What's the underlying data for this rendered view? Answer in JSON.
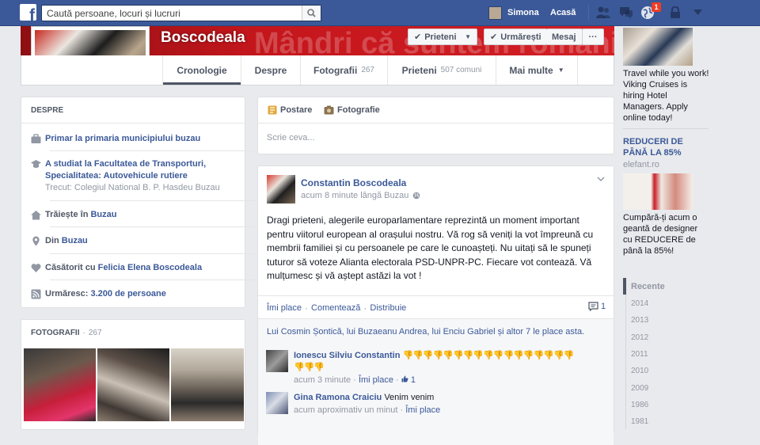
{
  "topbar": {
    "logo": "f",
    "search_placeholder": "Caută persoane, locuri și lucruri",
    "user_name": "Simona",
    "home_label": "Acasă",
    "notification_count": "1",
    "icons": [
      "friend-requests-icon",
      "messages-icon",
      "notifications-icon",
      "privacy-lock-icon",
      "settings-caret-icon"
    ]
  },
  "profile": {
    "name": "Boscodeala",
    "cover_motto": "Mândri că suntem români.",
    "buttons": {
      "friends": "Prieteni",
      "following": "Urmărești",
      "message": "Mesaj",
      "more": "···"
    },
    "tabs": [
      {
        "label": "Cronologie",
        "count": ""
      },
      {
        "label": "Despre",
        "count": ""
      },
      {
        "label": "Fotografii",
        "count": "267"
      },
      {
        "label": "Prieteni",
        "count": "507 comuni"
      },
      {
        "label": "Mai multe",
        "count": ""
      }
    ]
  },
  "about": {
    "title": "DESPRE",
    "items": [
      {
        "icon": "briefcase-icon",
        "text": "Primar la primaria municipiului buzau",
        "sub": ""
      },
      {
        "icon": "education-icon",
        "text": "A studiat la Facultatea de Transporturi, Specialitatea: Autovehicule rutiere",
        "sub": "Trecut: Colegiul National B. P. Hasdeu Buzau"
      },
      {
        "icon": "home-icon",
        "prefix": "Trăiește în ",
        "text": "Buzau",
        "sub": ""
      },
      {
        "icon": "location-pin-icon",
        "prefix": "Din ",
        "text": "Buzau",
        "sub": ""
      },
      {
        "icon": "heart-icon",
        "prefix": "Căsătorit cu ",
        "text": "Felicia Elena Boscodeala",
        "sub": ""
      },
      {
        "icon": "rss-icon",
        "prefix": "Urmăresc: ",
        "text": "3.200 de persoane",
        "sub": ""
      }
    ]
  },
  "photos": {
    "title": "FOTOGRAFII",
    "count": "267"
  },
  "composer": {
    "post_tab": "Postare",
    "photo_tab": "Fotografie",
    "placeholder": "Scrie ceva..."
  },
  "post": {
    "author": "Constantin Boscodeala",
    "meta": "acum 8 minute lângă Buzau",
    "body": "Dragi prieteni, alegerile europarlamentare reprezintă un moment important pentru viitorul european al orașului nostru. Vă rog să veniți la vot împreună cu membrii familiei și cu persoanele pe care le cunoașteți. Nu uitați să le spuneți tuturor să voteze Alianta electorala PSD-UNPR-PC. Fiecare vot contează. Vă mulțumesc și vă aștept astăzi la vot !",
    "actions": {
      "like": "Îmi place",
      "comment": "Comentează",
      "share": "Distribuie",
      "comment_count": "1"
    },
    "likes_line": "Lui Cosmin Șontică, lui Buzaeanu Andrea, lui Enciu Gabriel și altor 7 le place asta.",
    "comments": [
      {
        "author": "Ionescu Silviu Constantin",
        "text": "👎👎👎👎👎👎👎👎👎👎👎👎👎👎👎👎👎👎👎👎",
        "time": "acum 3 minute",
        "like": "Îmi place",
        "likes": "1"
      },
      {
        "author": "Gina Ramona Craiciu",
        "text": "Venim venim",
        "time": "acum aproximativ un minut",
        "like": "Îmi place"
      }
    ]
  },
  "sidebar": {
    "ads": [
      {
        "title": "",
        "text": "Travel while you work! Viking Cruises is hiring Hotel Managers. Apply online today!",
        "domain": ""
      },
      {
        "title": "REDUCERI DE PÂNĂ LA 85%",
        "domain": "elefant.ro",
        "text": "Cumpără-ți acum o geantă de designer cu REDUCERE de până la 85%!"
      }
    ],
    "timeline": {
      "recent": "Recente",
      "years": [
        "2014",
        "2013",
        "2012",
        "2011",
        "2010",
        "2009",
        "1986",
        "1981"
      ]
    }
  },
  "colors": {
    "facebook_blue": "#3b5998",
    "cover_red": "#c4161c",
    "page_background": "#e9eaed"
  }
}
